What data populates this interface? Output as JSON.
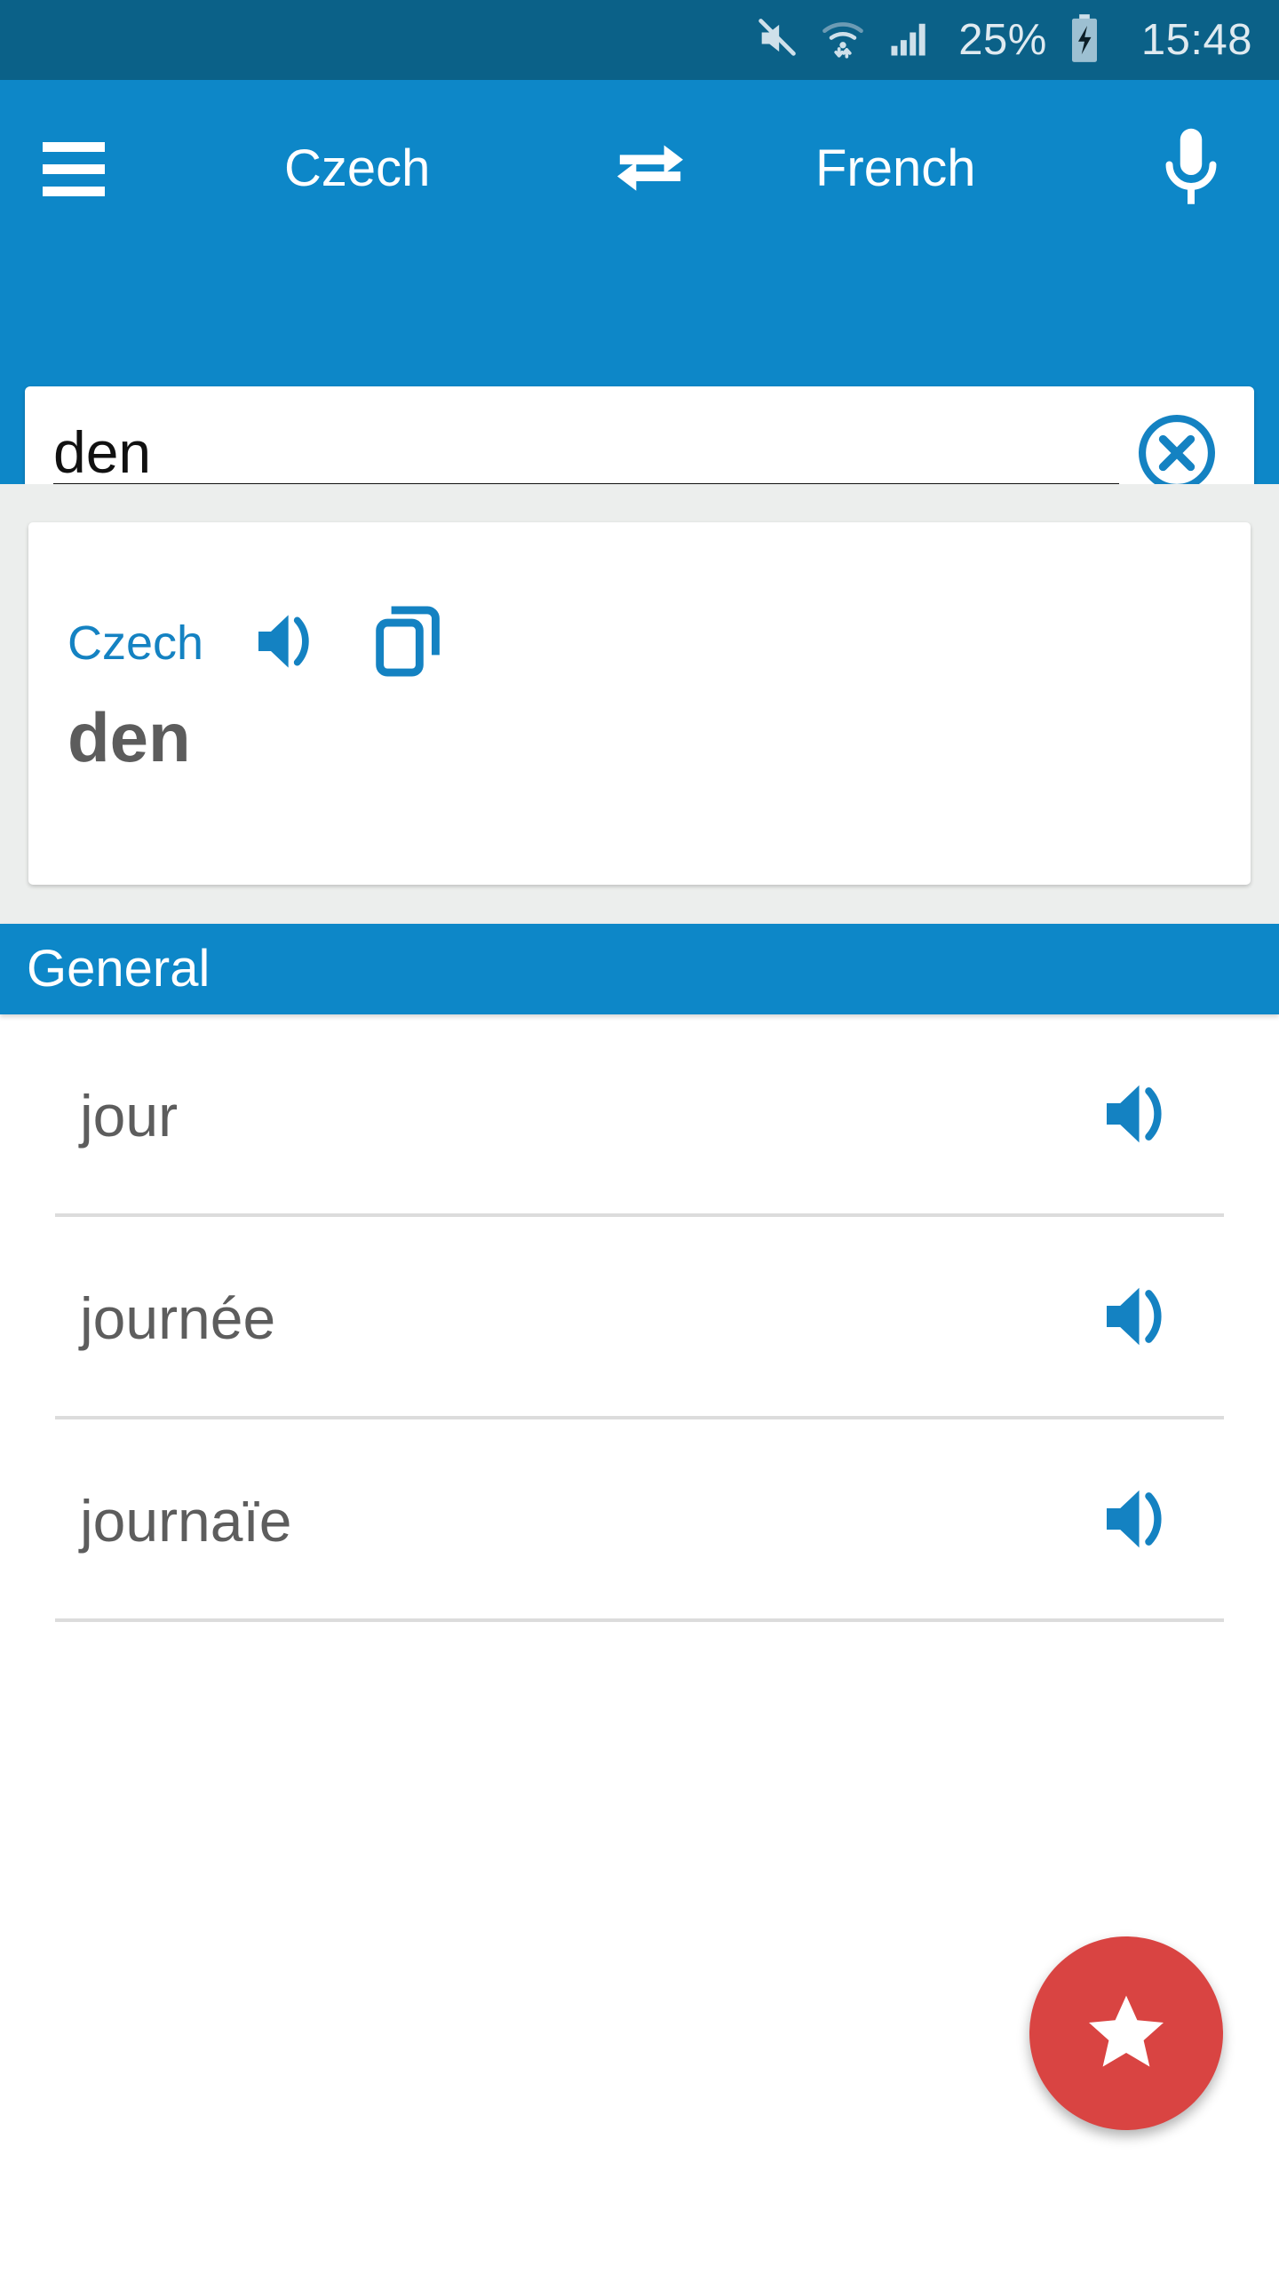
{
  "statusbar": {
    "mute_icon": "mute-icon",
    "wifi_icon": "wifi-icon",
    "signal_icon": "cellular-signal-icon",
    "battery_percent": "25%",
    "battery_icon": "battery-charging-icon",
    "clock": "15:48"
  },
  "appbar": {
    "menu_icon": "hamburger-menu-icon",
    "source_language": "Czech",
    "swap_icon": "swap-horizontal-icon",
    "target_language": "French",
    "mic_icon": "microphone-icon"
  },
  "search": {
    "value": "den",
    "placeholder": "",
    "clear_icon": "clear-circle-x-icon"
  },
  "card": {
    "language": "Czech",
    "speak_icon": "speaker-volume-icon",
    "copy_icon": "copy-icon",
    "word": "den"
  },
  "section": {
    "title": "General"
  },
  "results": [
    {
      "word": "jour",
      "speak_icon": "speaker-volume-icon"
    },
    {
      "word": "journée",
      "speak_icon": "speaker-volume-icon"
    },
    {
      "word": "journaïe",
      "speak_icon": "speaker-volume-icon"
    }
  ],
  "fab": {
    "icon": "star-icon",
    "color": "#d94442"
  },
  "colors": {
    "statusbar": "#0b6188",
    "appbar": "#0d87c8",
    "accent": "#1482c2",
    "background": "#eceeed",
    "text_grey": "#5d5d5d"
  }
}
